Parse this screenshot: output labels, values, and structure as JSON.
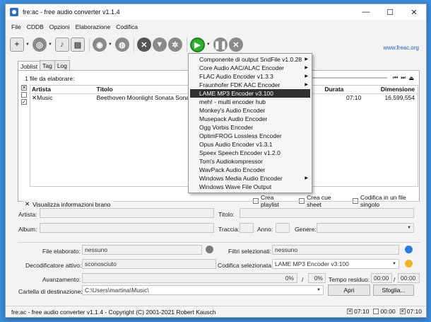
{
  "window": {
    "title": "fre:ac - free audio converter v1.1.4"
  },
  "titlebar_controls": [
    "—",
    "☐",
    "✕"
  ],
  "menu": [
    "File",
    "CDDB",
    "Opzioni",
    "Elaborazione",
    "Codifica"
  ],
  "weblink": "www.freac.org",
  "tabs": [
    "Joblist",
    "Tag",
    "Log"
  ],
  "joblist": {
    "count_text": "1 file da elaborare:",
    "columns": {
      "artist": "Artista",
      "title": "Titolo",
      "duration": "Durata",
      "size": "Dimensione"
    },
    "rows": [
      {
        "artist": "Music",
        "title": "Beethoven Moonlight Sonata Sonata",
        "duration": "07:10",
        "size": "16,599,554"
      }
    ]
  },
  "encoder_menu": {
    "items": [
      "Componente di output SndFile v1.0.28",
      "Core Audio AAC/ALAC Encoder",
      "FLAC Audio Encoder v1.3.3",
      "Fraunhofer FDK AAC Encoder",
      "LAME MP3 Encoder v3.100",
      "meh! - multi encoder hub",
      "Monkey's Audio Encoder",
      "Musepack Audio Encoder",
      "Ogg Vorbis Encoder",
      "OptimFROG Lossless Encoder",
      "Opus Audio Encoder v1.3.1",
      "Speex Speech Encoder v1.2.0",
      "Tom's Audiokompressor",
      "WavPack Audio Encoder",
      "Windows Media Audio Encoder",
      "Windows Wave File Output"
    ],
    "selected_index": 4,
    "submenu_indices": [
      0,
      1,
      2,
      3,
      14
    ]
  },
  "output_options": {
    "create_playlist": "Crea playlist",
    "create_cue": "Crea cue sheet",
    "single_file": "Codifica in un file singolo"
  },
  "track_info": {
    "toggle_label": "Visualizza informazioni brano",
    "artist_label": "Artista:",
    "title_label": "Titolo:",
    "album_label": "Album:",
    "track_label": "Traccia:",
    "year_label": "Anno:",
    "genre_label": "Genere:"
  },
  "status_panel": {
    "file_label": "File elaborato:",
    "file_value": "nessuno",
    "decoder_label": "Decodificatore attivo:",
    "decoder_value": "sconosciuto",
    "progress_label": "Avanzamento:",
    "progress_a": "0%",
    "progress_sep": "/",
    "progress_b": "0%",
    "filters_label": "Filtri selezionati:",
    "filters_value": "nessuno",
    "encoder_label": "Codifica selezionata:",
    "encoder_value": "LAME MP3 Encoder v3.100",
    "time_label": "Tempo residuo:",
    "time_a": "00:00",
    "time_b": "00:00",
    "dest_label": "Cartella di destinazione:",
    "dest_value": "C:\\Users\\martina\\Music\\",
    "open_button": "Apri",
    "browse_button": "Sfoglia..."
  },
  "statusbar": {
    "text": "fre:ac - free audio converter v1.1.4 - Copyright (C) 2001-2021 Robert Kausch",
    "t1": "07:10",
    "t2": "00:00",
    "t3": "07:10"
  }
}
